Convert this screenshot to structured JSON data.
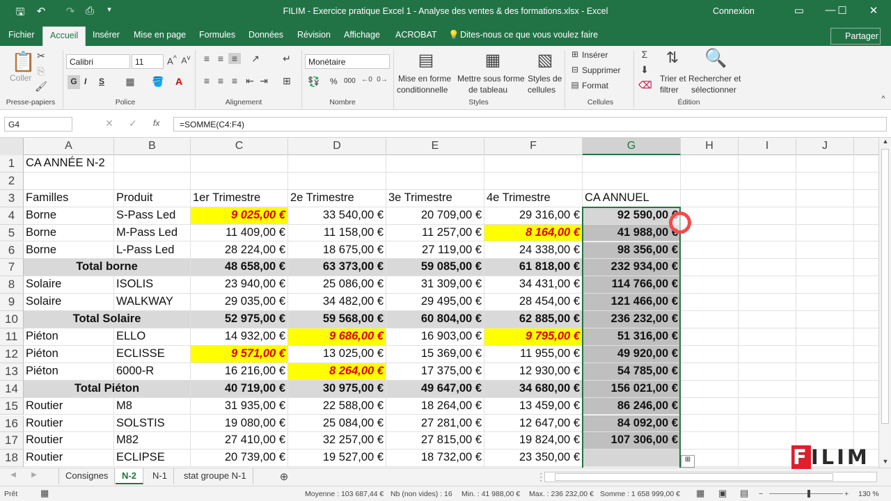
{
  "titlebar": {
    "title": "FILIM - Exercice pratique Excel 1 - Analyse des ventes &  des formations.xlsx  -  Excel",
    "connexion": "Connexion"
  },
  "tabs": [
    "Fichier",
    "Accueil",
    "Insérer",
    "Mise en page",
    "Formules",
    "Données",
    "Révision",
    "Affichage",
    "ACROBAT"
  ],
  "tellme": "Dites-nous ce que vous voulez faire",
  "share": "Partager",
  "ribbon": {
    "coller": "Coller",
    "presse": "Presse-papiers",
    "font": "Calibri",
    "size": "11",
    "police": "Police",
    "alignement": "Alignement",
    "format": "Monétaire",
    "nombre": "Nombre",
    "mfc1": "Mise en forme",
    "mfc2": "conditionnelle",
    "mst1": "Mettre sous forme",
    "mst2": "de tableau",
    "sty1": "Styles de",
    "sty2": "cellules",
    "styles": "Styles",
    "inserer": "Insérer",
    "supprimer": "Supprimer",
    "formatc": "Format",
    "cellules": "Cellules",
    "trier1": "Trier et",
    "trier2": "filtrer",
    "rech1": "Rechercher et",
    "rech2": "sélectionner",
    "edition": "Édition",
    "bold": "G",
    "italic": "I",
    "underline": "S",
    "pct": "%",
    "thousands": "000"
  },
  "formula_bar": {
    "name_box": "G4",
    "fx": "fx",
    "formula": "=SOMME(C4:F4)"
  },
  "columns": [
    "A",
    "B",
    "C",
    "D",
    "E",
    "F",
    "G",
    "H",
    "I",
    "J"
  ],
  "rows": [
    {
      "n": "1",
      "type": "title",
      "a": "CA ANNÉE N-2"
    },
    {
      "n": "2",
      "type": "blank"
    },
    {
      "n": "3",
      "type": "header",
      "a": "Familles",
      "b": "Produit",
      "c": "1er Trimestre",
      "d": "2e Trimestre",
      "e": "3e Trimestre",
      "f": "4e Trimestre",
      "g": "CA ANNUEL"
    },
    {
      "n": "4",
      "type": "data",
      "a": "Borne",
      "b": "S-Pass Led",
      "c": "9 025,00 €",
      "d": "33 540,00 €",
      "e": "20 709,00 €",
      "f": "29 316,00 €",
      "g": "92 590,00 €",
      "hl": [
        "c"
      ]
    },
    {
      "n": "5",
      "type": "data",
      "a": "Borne",
      "b": "M-Pass Led",
      "c": "11 409,00 €",
      "d": "11 158,00 €",
      "e": "11 257,00 €",
      "f": "8 164,00 €",
      "g": "41 988,00 €",
      "hl": [
        "f"
      ]
    },
    {
      "n": "6",
      "type": "data",
      "a": "Borne",
      "b": "L-Pass Led",
      "c": "28 224,00 €",
      "d": "18 675,00 €",
      "e": "27 119,00 €",
      "f": "24 338,00 €",
      "g": "98 356,00 €",
      "hl": []
    },
    {
      "n": "7",
      "type": "total",
      "a": "Total borne",
      "c": "48 658,00 €",
      "d": "63 373,00 €",
      "e": "59 085,00 €",
      "f": "61 818,00 €",
      "g": "232 934,00 €"
    },
    {
      "n": "8",
      "type": "data",
      "a": "Solaire",
      "b": "ISOLIS",
      "c": "23 940,00 €",
      "d": "25 086,00 €",
      "e": "31 309,00 €",
      "f": "34 431,00 €",
      "g": "114 766,00 €",
      "hl": []
    },
    {
      "n": "9",
      "type": "data",
      "a": "Solaire",
      "b": "WALKWAY",
      "c": "29 035,00 €",
      "d": "34 482,00 €",
      "e": "29 495,00 €",
      "f": "28 454,00 €",
      "g": "121 466,00 €",
      "hl": []
    },
    {
      "n": "10",
      "type": "total",
      "a": "Total Solaire",
      "c": "52 975,00 €",
      "d": "59 568,00 €",
      "e": "60 804,00 €",
      "f": "62 885,00 €",
      "g": "236 232,00 €"
    },
    {
      "n": "11",
      "type": "data",
      "a": "Piéton",
      "b": "ELLO",
      "c": "14 932,00 €",
      "d": "9 686,00 €",
      "e": "16 903,00 €",
      "f": "9 795,00 €",
      "g": "51 316,00 €",
      "hl": [
        "d",
        "f"
      ]
    },
    {
      "n": "12",
      "type": "data",
      "a": "Piéton",
      "b": "ECLISSE",
      "c": "9 571,00 €",
      "d": "13 025,00 €",
      "e": "15 369,00 €",
      "f": "11 955,00 €",
      "g": "49 920,00 €",
      "hl": [
        "c"
      ]
    },
    {
      "n": "13",
      "type": "data",
      "a": "Piéton",
      "b": "6000-R",
      "c": "16 216,00 €",
      "d": "8 264,00 €",
      "e": "17 375,00 €",
      "f": "12 930,00 €",
      "g": "54 785,00 €",
      "hl": [
        "d"
      ]
    },
    {
      "n": "14",
      "type": "total",
      "a": "Total Piéton",
      "c": "40 719,00 €",
      "d": "30 975,00 €",
      "e": "49 647,00 €",
      "f": "34 680,00 €",
      "g": "156 021,00 €"
    },
    {
      "n": "15",
      "type": "data",
      "a": "Routier",
      "b": "M8",
      "c": "31 935,00 €",
      "d": "22 588,00 €",
      "e": "18 264,00 €",
      "f": "13 459,00 €",
      "g": "86 246,00 €",
      "hl": []
    },
    {
      "n": "16",
      "type": "data",
      "a": "Routier",
      "b": "SOLSTIS",
      "c": "19 080,00 €",
      "d": "25 084,00 €",
      "e": "27 281,00 €",
      "f": "12 647,00 €",
      "g": "84 092,00 €",
      "hl": []
    },
    {
      "n": "17",
      "type": "data",
      "a": "Routier",
      "b": "M82",
      "c": "27 410,00 €",
      "d": "32 257,00 €",
      "e": "27 815,00 €",
      "f": "19 824,00 €",
      "g": "107 306,00 €",
      "hl": []
    },
    {
      "n": "18",
      "type": "data",
      "a": "Routier",
      "b": "ECLIPSE",
      "c": "20 739,00 €",
      "d": "19 527,00 €",
      "e": "18 732,00 €",
      "f": "23 350,00 €",
      "g": "",
      "hl": []
    }
  ],
  "sheets": [
    "Consignes",
    "N-2",
    "N-1",
    "stat groupe N-1"
  ],
  "active_sheet": "N-2",
  "status": {
    "ready": "Prêt",
    "avg": "Moyenne : 103 687,44 €",
    "count": "Nb (non vides) : 16",
    "min": "Min. : 41 988,00 €",
    "max": "Max. : 236 232,00 €",
    "sum": "Somme : 1 658 999,00 €",
    "zoom": "130 %"
  },
  "logo": {
    "f": "F",
    "rest": "ILIM"
  }
}
